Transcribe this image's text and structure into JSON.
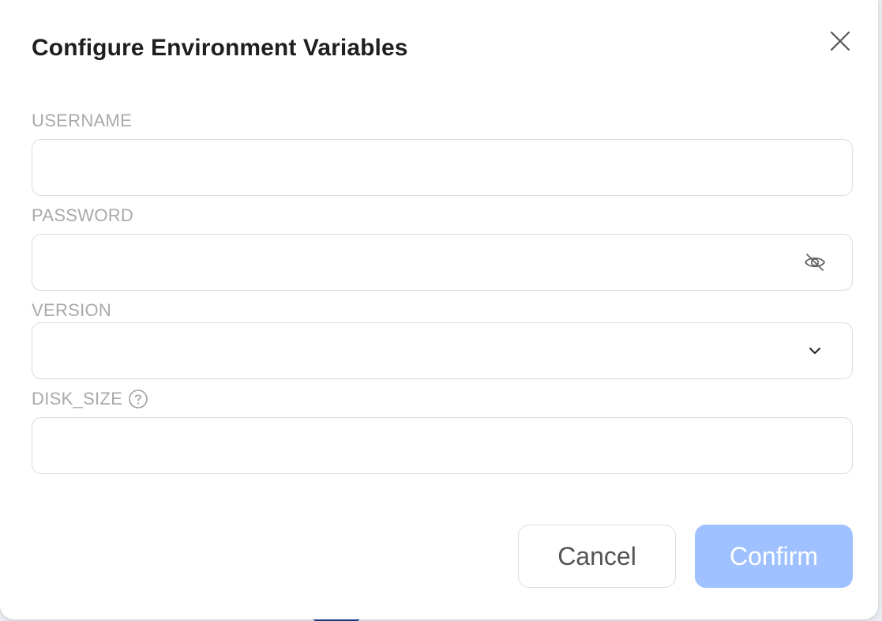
{
  "dialog": {
    "title": "Configure Environment Variables"
  },
  "fields": {
    "username": {
      "label": "USERNAME",
      "value": "",
      "placeholder": ""
    },
    "password": {
      "label": "PASSWORD",
      "value": "",
      "placeholder": ""
    },
    "version": {
      "label": "VERSION",
      "value": ""
    },
    "disk_size": {
      "label": "DISK_SIZE",
      "value": "",
      "placeholder": ""
    }
  },
  "icons": {
    "close": "close-icon",
    "password_toggle": "eye-off-icon",
    "version_dropdown": "chevron-down-icon",
    "disk_help": "help-circle-icon"
  },
  "buttons": {
    "cancel": "Cancel",
    "confirm": "Confirm"
  },
  "colors": {
    "confirm_bg": "#9fc1ff",
    "label_text": "#a9a9a9",
    "border": "#dcdcdc"
  }
}
